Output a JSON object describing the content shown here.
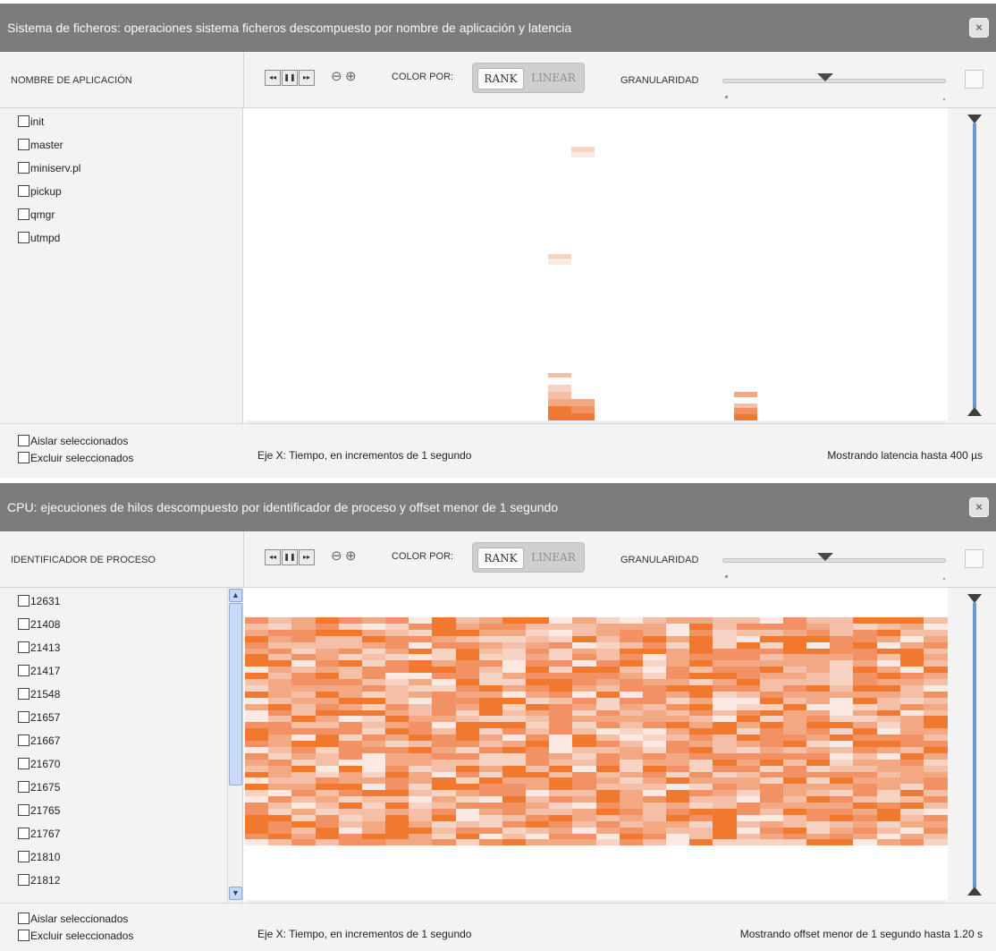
{
  "colors": {
    "title_bar": "#7c7c7c",
    "heat_scale": [
      "#fbe9e2",
      "#f7d3c3",
      "#f5bea6",
      "#f3a884",
      "#f29163",
      "#f0782f"
    ],
    "slider_track": "#6d9acb"
  },
  "panels": [
    {
      "title": "Sistema de ficheros: operaciones sistema ficheros descompuesto por nombre de aplicación y latencia",
      "close_icon": "×",
      "list_header": "NOMBRE DE APLICACIÓN",
      "controls": {
        "rewind": "◂◂",
        "pause": "❚❚",
        "forward": "▸▸"
      },
      "zoom_out": "⊖",
      "zoom_in": "⊕",
      "color_by_label": "COLOR POR:",
      "color_modes": [
        "RANK",
        "LINEAR"
      ],
      "active_color_mode": "RANK",
      "granularity_label": "GRANULARIDAD",
      "granularity_level": 0.45,
      "items": [
        "init",
        "master",
        "miniserv.pl",
        "pickup",
        "qmgr",
        "utmpd"
      ],
      "isolate_label": "Aislar seleccionados",
      "exclude_label": "Excluir seleccionados",
      "x_axis_text": "Eje X: Tiempo, en incrementos de 1 segundo",
      "range_text": "Mostrando latencia hasta 400 µs"
    },
    {
      "title": "CPU: ejecuciones de hilos descompuesto por identificador de proceso y offset menor de 1 segundo",
      "close_icon": "×",
      "list_header": "IDENTIFICADOR DE PROCESO",
      "controls": {
        "rewind": "◂◂",
        "pause": "❚❚",
        "forward": "▸▸"
      },
      "zoom_out": "⊖",
      "zoom_in": "⊕",
      "color_by_label": "COLOR POR:",
      "color_modes": [
        "RANK",
        "LINEAR"
      ],
      "active_color_mode": "RANK",
      "granularity_label": "GRANULARIDAD",
      "granularity_level": 0.45,
      "items": [
        "12631",
        "21408",
        "21413",
        "21417",
        "21548",
        "21657",
        "21667",
        "21670",
        "21675",
        "21765",
        "21767",
        "21810",
        "21812"
      ],
      "isolate_label": "Aislar seleccionados",
      "exclude_label": "Excluir seleccionados",
      "x_axis_text": "Eje X: Tiempo, en incrementos de 1 segundo",
      "range_text": "Mostrando offset menor de 1 segundo hasta 1.20 s"
    }
  ]
}
